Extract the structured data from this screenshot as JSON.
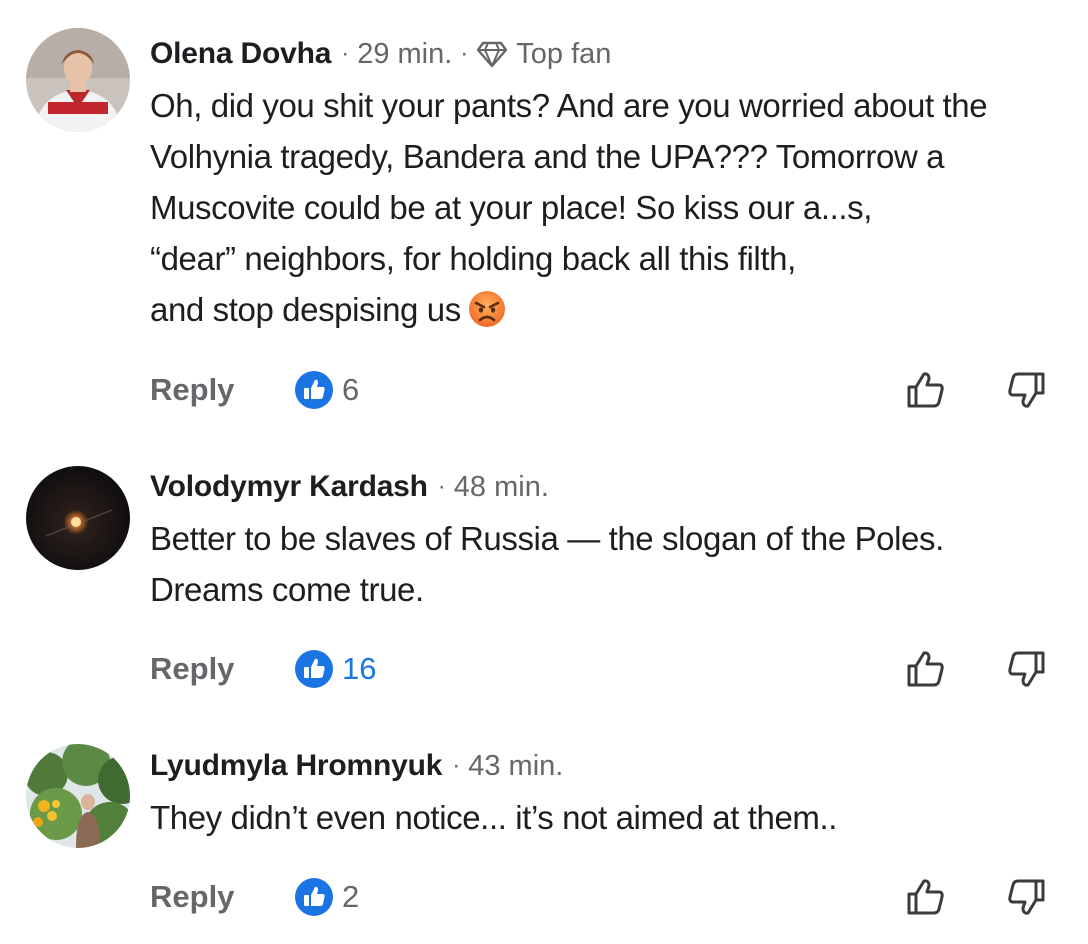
{
  "comments": [
    {
      "author": "Olena Dovha",
      "time": "29 min.",
      "badge": "Top fan",
      "badge_icon": "diamond-icon",
      "text_lines": [
        "Oh, did you shit your pants? And are you worried about the",
        "Volhynia tragedy, Bandera and the UPA??? Tomorrow a",
        "Muscovite could be at your place! So kiss our a...s,",
        "“dear” neighbors, for holding back all this filth,",
        "and stop despising us"
      ],
      "trailing_emoji": "angry-face-emoji",
      "reply_label": "Reply",
      "like_count": "6",
      "like_count_color": "#65676b"
    },
    {
      "author": "Volodymyr Kardash",
      "time": "48 min.",
      "text_lines": [
        "Better to be slaves of Russia — the slogan of the Poles.",
        "Dreams come true."
      ],
      "reply_label": "Reply",
      "like_count": "16",
      "like_count_color": "#1b74e4"
    },
    {
      "author": "Lyudmyla Hromnyuk",
      "time": "43 min.",
      "text_lines": [
        "They didn’t even notice... it’s not aimed at them.."
      ],
      "reply_label": "Reply",
      "like_count": "2",
      "like_count_color": "#65676b"
    }
  ],
  "colors": {
    "like_blue": "#1b74e4",
    "secondary_text": "#65676b",
    "primary_text": "#1c1e21"
  }
}
